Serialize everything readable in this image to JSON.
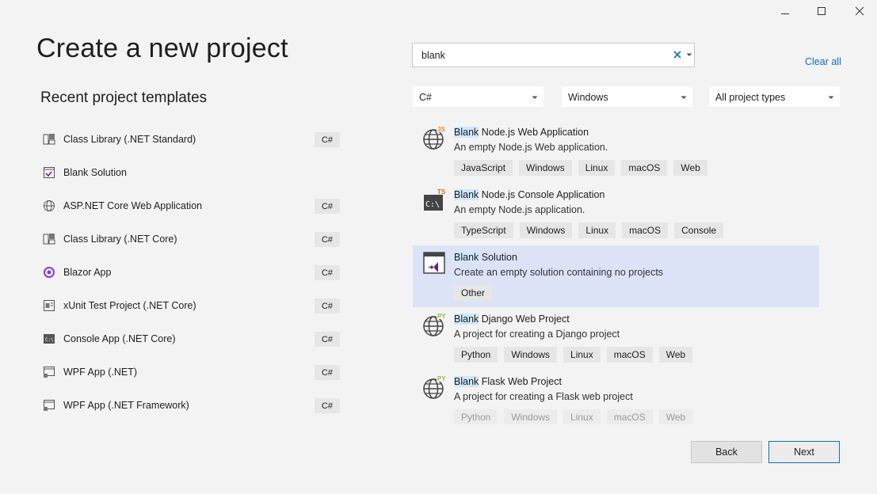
{
  "window_controls": {
    "minimize": "minimize-icon",
    "maximize": "maximize-icon",
    "close": "close-icon"
  },
  "header": {
    "title": "Create a new project"
  },
  "recent": {
    "title": "Recent project templates",
    "items": [
      {
        "label": "Class Library (.NET Standard)",
        "lang": "C#",
        "icon": "class-library-icon"
      },
      {
        "label": "Blank Solution",
        "lang": "",
        "icon": "solution-icon"
      },
      {
        "label": "ASP.NET Core Web Application",
        "lang": "C#",
        "icon": "globe-icon"
      },
      {
        "label": "Class Library (.NET Core)",
        "lang": "C#",
        "icon": "class-library-icon"
      },
      {
        "label": "Blazor App",
        "lang": "C#",
        "icon": "blazor-icon"
      },
      {
        "label": "xUnit Test Project (.NET Core)",
        "lang": "C#",
        "icon": "test-icon"
      },
      {
        "label": "Console App (.NET Core)",
        "lang": "C#",
        "icon": "console-icon"
      },
      {
        "label": "WPF App (.NET)",
        "lang": "C#",
        "icon": "wpf-icon"
      },
      {
        "label": "WPF App (.NET Framework)",
        "lang": "C#",
        "icon": "wpf-icon"
      }
    ]
  },
  "search": {
    "value": "blank",
    "clear_icon": "clear-icon",
    "dropdown_icon": "chevron-down-icon"
  },
  "clear_all": "Clear all",
  "filters": {
    "language": "C#",
    "platform": "Windows",
    "project_type": "All project types"
  },
  "results": [
    {
      "highlight": "Blank",
      "name_rest": " Node.js Web Application",
      "description": "An empty Node.js Web application.",
      "tags": [
        "JavaScript",
        "Windows",
        "Linux",
        "macOS",
        "Web"
      ],
      "icon_badge": "JS"
    },
    {
      "highlight": "Blank",
      "name_rest": " Node.js Console Application",
      "description": "An empty Node.js application.",
      "tags": [
        "TypeScript",
        "Windows",
        "Linux",
        "macOS",
        "Console"
      ],
      "icon_badge": "TS"
    },
    {
      "highlight": "Blank",
      "name_rest": " Solution",
      "description": "Create an empty solution containing no projects",
      "tags": [
        "Other"
      ],
      "icon_badge": ""
    },
    {
      "highlight": "Blank",
      "name_rest": " Django Web Project",
      "description": "A project for creating a Django project",
      "tags": [
        "Python",
        "Windows",
        "Linux",
        "macOS",
        "Web"
      ],
      "icon_badge": "PY"
    },
    {
      "highlight": "Blank",
      "name_rest": " Flask Web Project",
      "description": "A project for creating a Flask web project",
      "tags": [
        "Python",
        "Windows",
        "Linux",
        "macOS",
        "Web"
      ],
      "icon_badge": "PY"
    }
  ],
  "buttons": {
    "back": "Back",
    "next": "Next"
  },
  "colors": {
    "accent": "#0e70c0",
    "selected_bg": "#dde3f7",
    "highlight": "#cfe8fc",
    "js": "#e8822a",
    "ts": "#d96a2a",
    "py": "#8fbf3a",
    "vs_purple": "#68217a"
  }
}
